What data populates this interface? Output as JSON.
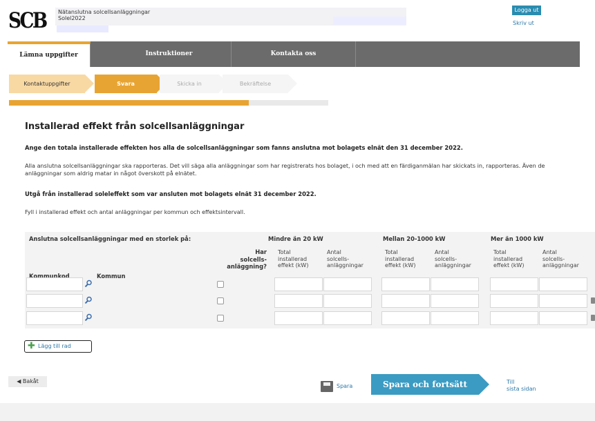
{
  "header": {
    "logo_text": "SCB",
    "survey_name": "Nätanslutna solcellsanläggningar",
    "survey_code": "Solel2022",
    "logout_label": "Logga ut",
    "print_label": "Skriv ut"
  },
  "nav": {
    "tabs": [
      {
        "label": "Lämna uppgifter",
        "active": true
      },
      {
        "label": "Instruktioner",
        "active": false
      },
      {
        "label": "Kontakta oss",
        "active": false
      }
    ]
  },
  "steps": [
    {
      "label": "Kontaktuppgifter",
      "state": "done"
    },
    {
      "label": "Svara",
      "state": "active"
    },
    {
      "label": "Skicka in",
      "state": "todo"
    },
    {
      "label": "Bekräftelse",
      "state": "todo"
    }
  ],
  "progress": {
    "fraction": 0.75
  },
  "main": {
    "title": "Installerad effekt från solcellsanläggningar",
    "lead": "Ange den totala installerade effekten hos alla de solcellsanläggningar som fanns anslutna mot bolagets elnät den 31 december 2022.",
    "info": "Alla anslutna solcellsanläggningar ska rapporteras. Det vill säga alla anläggningar som har registrerats hos bolaget, i och med att en färdiganmälan har skickats in, rapporteras. Även de anläggningar som aldrig matar in något överskott på elnätet.",
    "note": "Utgå från installerad soleleffekt som var ansluten mot bolagets elnät 31 december 2022.",
    "fill_info": "Fyll i installerad effekt och antal anläggningar per kommun och effektsintervall."
  },
  "table": {
    "group_header": "Anslutna solcellsanläggningar med en storlek på:",
    "col_kommunkod": "Kommunkod",
    "col_kommun": "Kommun",
    "col_har": [
      "Har",
      "solcells-",
      "anläggning?"
    ],
    "bands": [
      {
        "label": "Mindre än 20 kW",
        "effekt": [
          "Total",
          "installerad",
          "effekt (kW)"
        ],
        "antal": [
          "Antal",
          "solcells-",
          "anläggningar"
        ]
      },
      {
        "label": "Mellan 20-1000 kW",
        "effekt": [
          "Total",
          "installerad",
          "effekt (kW)"
        ],
        "antal": [
          "Antal",
          "solcells-",
          "anläggningar"
        ]
      },
      {
        "label": "Mer än 1000 kW",
        "effekt": [
          "Total",
          "installerad",
          "effekt (kW)"
        ],
        "antal": [
          "Antal",
          "solcells-",
          "anläggningar"
        ]
      }
    ],
    "rows": [
      {
        "kommunkod": "",
        "kommun": "",
        "har": false
      },
      {
        "kommunkod": "",
        "kommun": "",
        "har": false
      },
      {
        "kommunkod": "",
        "kommun": "",
        "har": false
      }
    ]
  },
  "add_row_label": "Lägg till rad",
  "bottom": {
    "back_label": "◀ Bakåt",
    "save_label": "Spara",
    "continue_label": "Spara och fortsätt",
    "to_last": [
      "Till",
      "sista sidan"
    ]
  },
  "colors": {
    "accent_orange": "#e8a432",
    "button_blue": "#3b9bc2",
    "nav_gray": "#6b6b6b",
    "link_blue": "#2b77a8"
  }
}
